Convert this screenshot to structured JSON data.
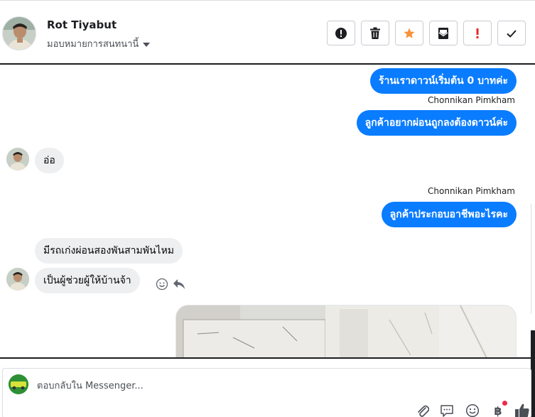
{
  "header": {
    "contact_name": "Rot Tiyabut",
    "assign_label": "มอบหมายการสนทนานี้",
    "actions": [
      {
        "name": "report-spam-button",
        "icon": "alert-circle-icon"
      },
      {
        "name": "delete-button",
        "icon": "trash-icon"
      },
      {
        "name": "star-button",
        "icon": "star-icon",
        "color": "#f7923b"
      },
      {
        "name": "mark-unread-button",
        "icon": "envelope-icon"
      },
      {
        "name": "follow-up-button",
        "icon": "exclamation-icon",
        "color": "#e02828"
      },
      {
        "name": "mark-done-button",
        "icon": "check-icon"
      }
    ]
  },
  "messages": [
    {
      "direction": "out",
      "text": "ร้านเราดาวน์เริ่มต้น 0 บาทค่ะ"
    },
    {
      "direction": "out",
      "sender": "Chonnikan Pimkham",
      "text": "ลูกค้าอยากผ่อนถูกลงต้องดาวน์ค่ะ"
    },
    {
      "direction": "in",
      "text": "อ่อ"
    },
    {
      "direction": "out",
      "sender": "Chonnikan Pimkham",
      "text": "ลูกค้าประกอบอาชีพอะไรคะ"
    },
    {
      "direction": "in",
      "text": "มีรถเก่งผ่อนสองพันสามพันไหม"
    },
    {
      "direction": "in",
      "text": "เป็นผู้ช่วยผู้ให้บ้านจ้า"
    }
  ],
  "reply": {
    "placeholder": "ตอบกลับใน Messenger..."
  },
  "colors": {
    "outgoing_bubble": "#0a7cff",
    "incoming_bubble": "#eeeff1",
    "notification_dot": "#f02849"
  }
}
